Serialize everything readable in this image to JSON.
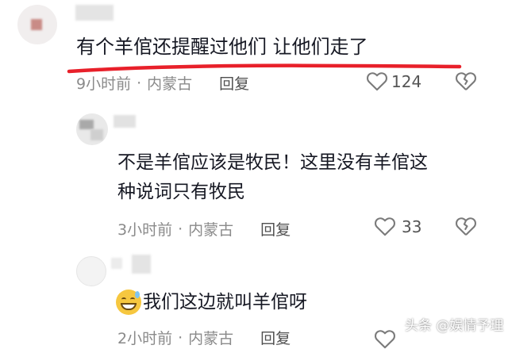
{
  "comments": [
    {
      "text": "有个羊倌还提醒过他们 让他们走了",
      "time": "9小时前",
      "sep": "·",
      "location": "内蒙古",
      "reply": "回复",
      "likes": "124"
    },
    {
      "text_line1": "不是羊倌应该是牧民！这里没有羊倌这",
      "text_line2": "种说词只有牧民",
      "time": "3小时前",
      "sep": "·",
      "location": "内蒙古",
      "reply": "回复",
      "likes": "33"
    },
    {
      "emoji": "😅",
      "text": "我们这边就叫羊倌呀",
      "time": "2小时前",
      "sep": "·",
      "location": "内蒙古",
      "reply": "回复"
    }
  ],
  "watermark": "头条 @娱情予理",
  "colors": {
    "underline": "#e8202a",
    "meta": "#8a8a8a",
    "icon": "#7a7a7a"
  }
}
